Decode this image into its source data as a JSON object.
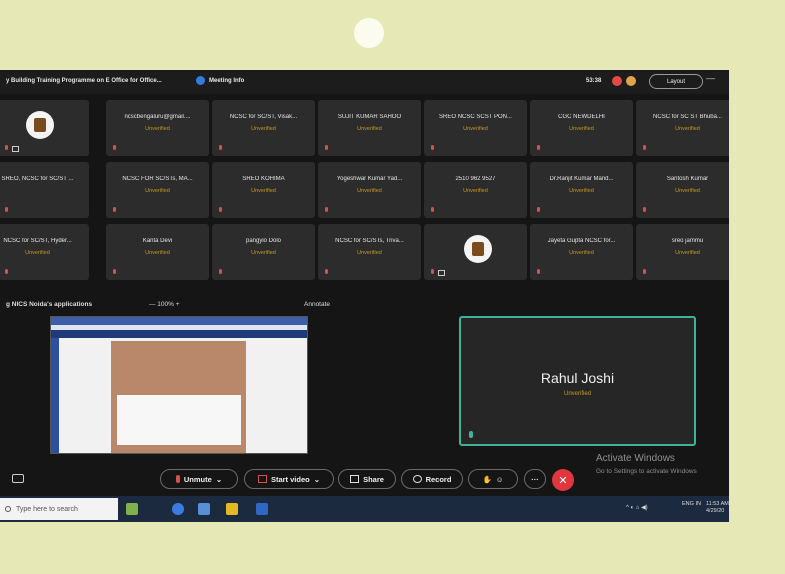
{
  "window": {
    "title": "y Building Training Programme on E Office for Office...",
    "meeting_info": "Meeting Info",
    "time": "53:38",
    "layout_label": "Layout"
  },
  "tiles": [
    {
      "name": "",
      "status": "",
      "emblem": true,
      "cam": true
    },
    {
      "name": "ncscbengaluru@gmail....",
      "status": "Unverified"
    },
    {
      "name": "NCSC for SC/ST, Visak...",
      "status": "Unverified"
    },
    {
      "name": "SUJIT KUMAR SAHOO",
      "status": "Unverified"
    },
    {
      "name": "SREO NCSC SCST PON...",
      "status": "Unverified"
    },
    {
      "name": "CGC NEWDELHI",
      "status": "Unverified"
    },
    {
      "name": "NCSC for SC ST Bhuba...",
      "status": "Unverified"
    },
    {
      "name": "SREO, NCSC for SC/ST ...",
      "status": ""
    },
    {
      "name": "NCSC FOR SC/STs, MA...",
      "status": "Unverified"
    },
    {
      "name": "SREO KOHIMA",
      "status": "Unverified"
    },
    {
      "name": "Yogeshwar Kumar Yad...",
      "status": "Unverified"
    },
    {
      "name": "2510 962 9527",
      "status": "Unverified"
    },
    {
      "name": "Dr.Ranjit Kumar Mand...",
      "status": "Unverified"
    },
    {
      "name": "Santosh Kumar",
      "status": "Unverified"
    },
    {
      "name": "NCSC for SC/ST, Hyder...",
      "status": "Unverified"
    },
    {
      "name": "Kanta Devi",
      "status": "Unverified"
    },
    {
      "name": "pangyio Dolo",
      "status": "Unverified"
    },
    {
      "name": "NCSC for SC/STs, Triva...",
      "status": "Unverified"
    },
    {
      "name": "",
      "status": "",
      "emblem": true,
      "cam": true
    },
    {
      "name": "Jayeta Gupta NCSC for...",
      "status": "Unverified"
    },
    {
      "name": "sreo jammu",
      "status": "Unverified"
    }
  ],
  "share": {
    "label": "g NICS Noida's applications",
    "zoom": "—   100%   +",
    "annotate": "Annotate"
  },
  "speaker": {
    "name": "Rahul Joshi",
    "status": "Unverified"
  },
  "toolbar": {
    "unmute": "Unmute",
    "start_video": "Start video",
    "share": "Share",
    "record": "Record"
  },
  "watermark": {
    "line1": "Activate Windows",
    "line2": "Go to Settings to activate Windows"
  },
  "taskbar": {
    "search_placeholder": "Type here to search",
    "lang": "ENG IN",
    "time": "11:53 AM",
    "date": "4/29/20"
  },
  "colors": {
    "background": "#e6e8b6",
    "accent_green": "#3fb39a",
    "unverified": "#c79a1c",
    "end_call": "#e0363d"
  }
}
